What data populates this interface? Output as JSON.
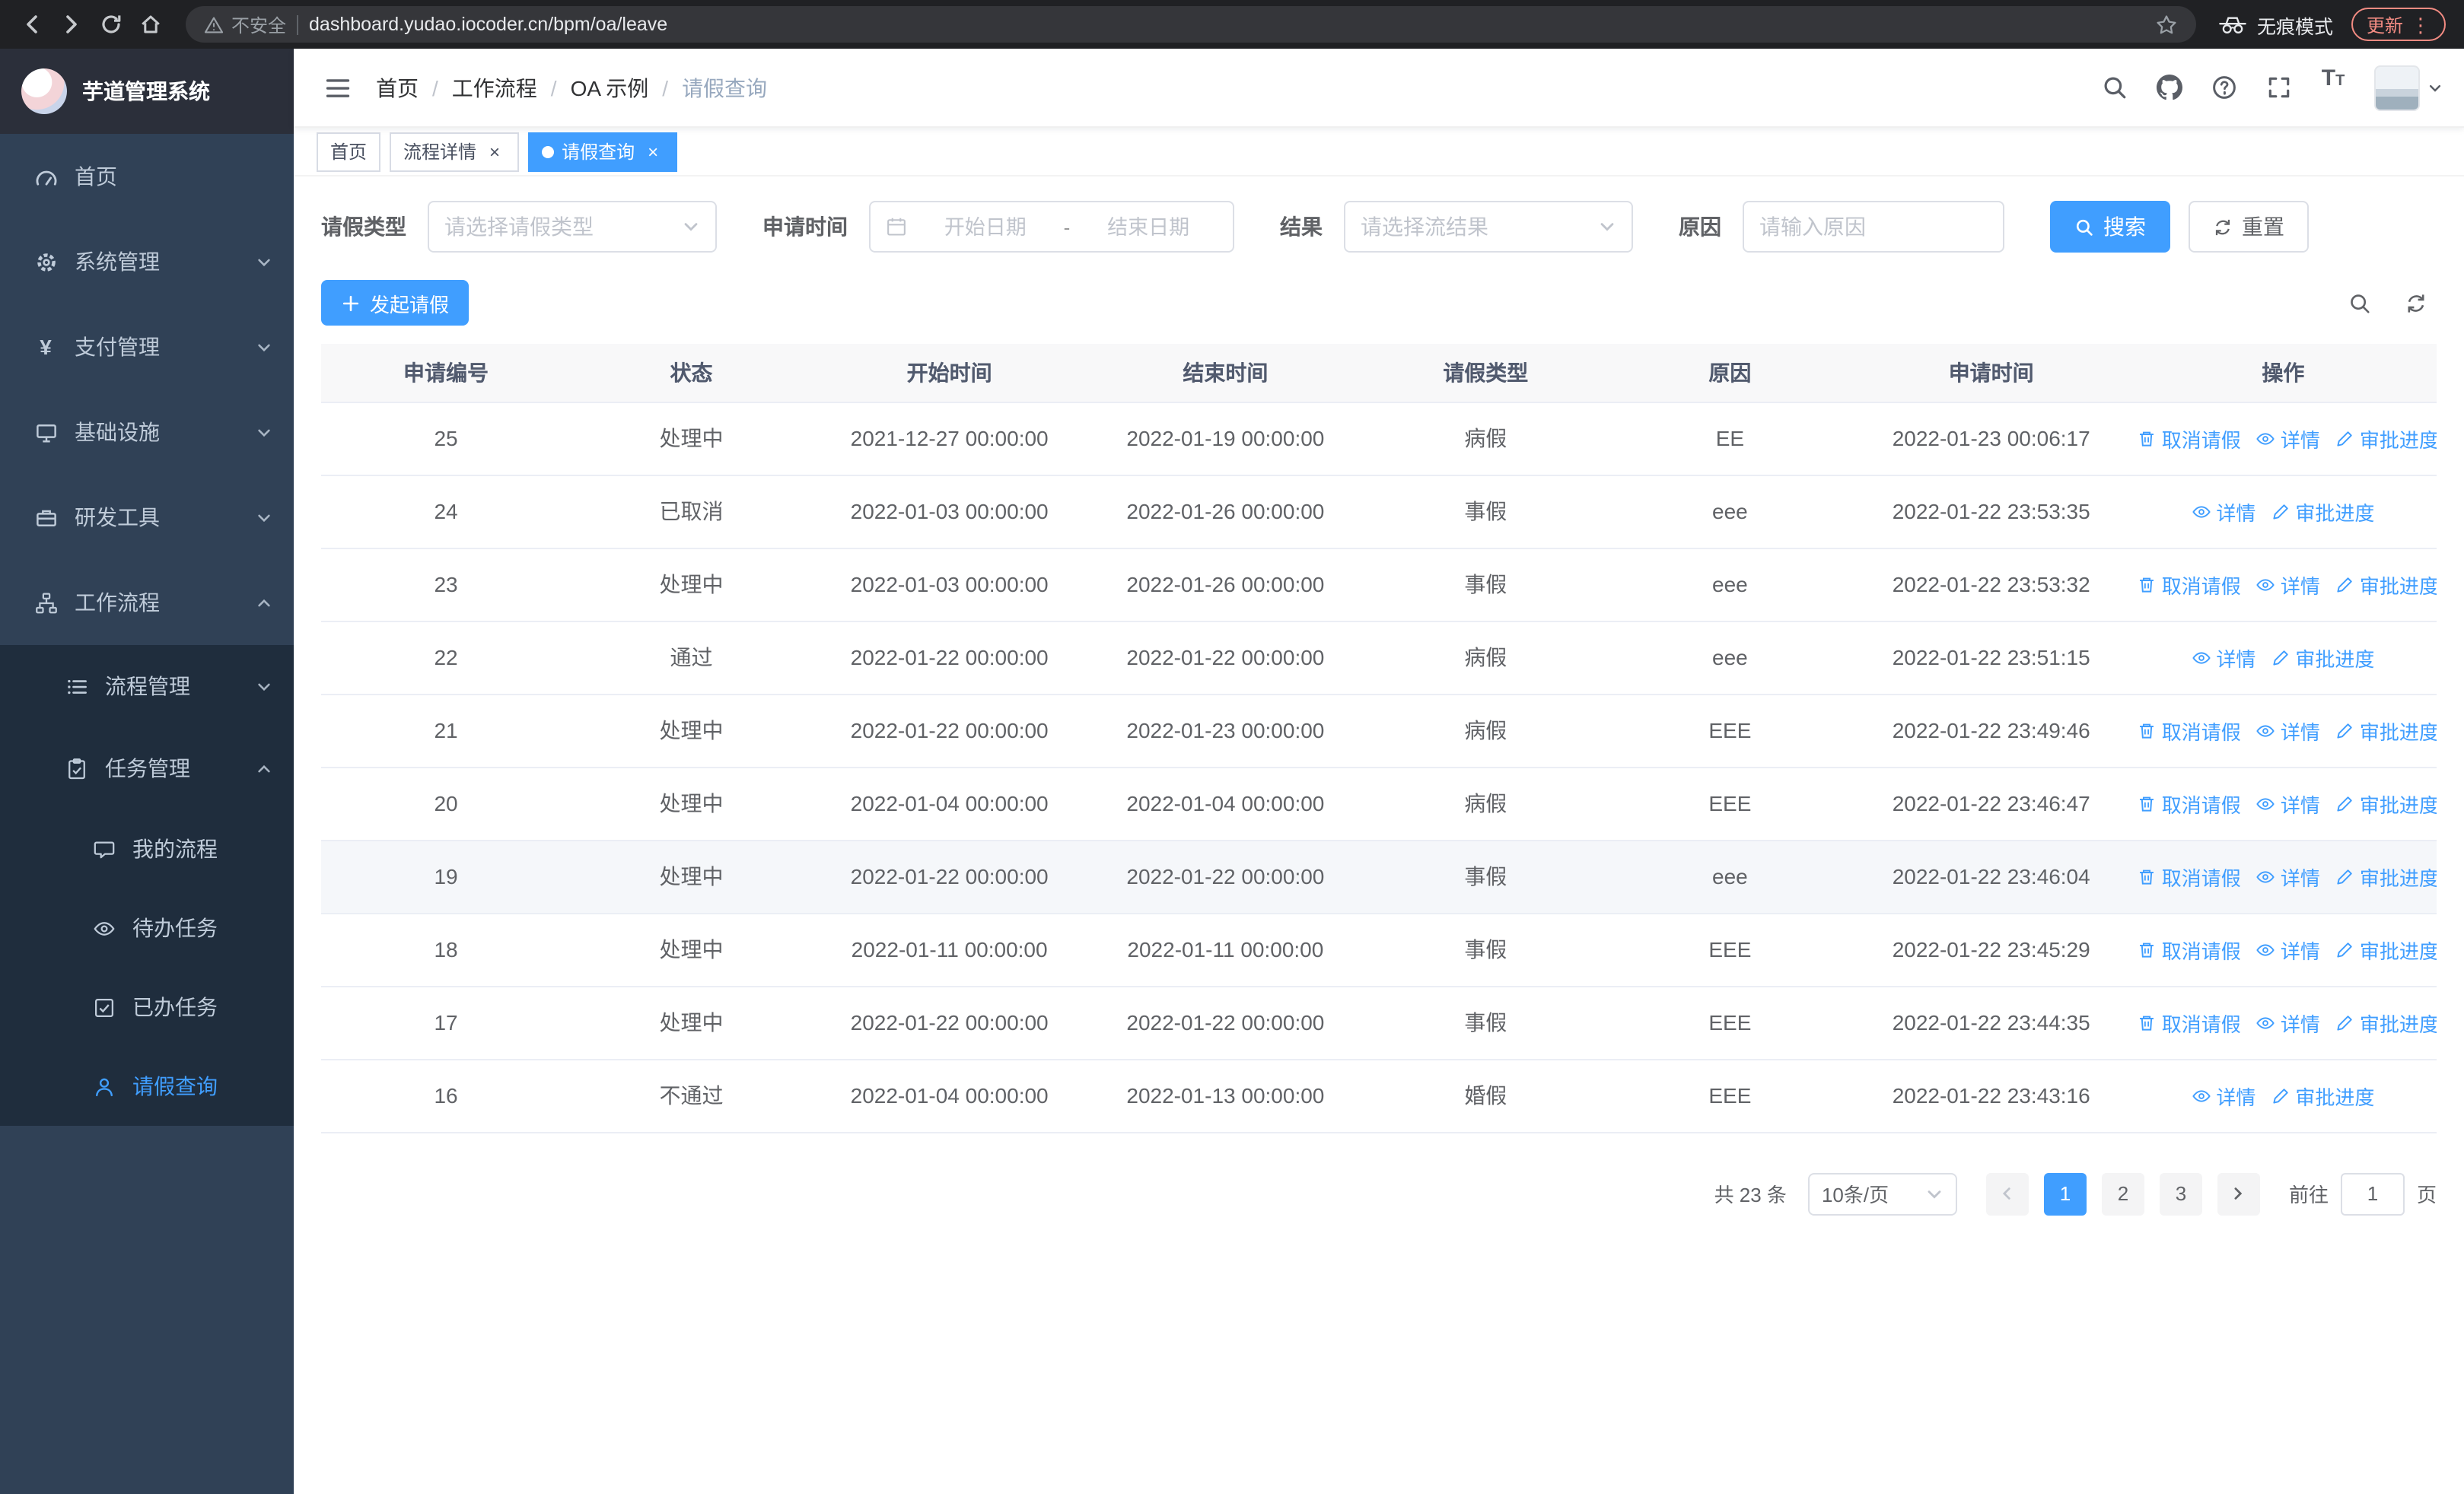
{
  "browser": {
    "security_label": "不安全",
    "url": "dashboard.yudao.iocoder.cn/bpm/oa/leave",
    "incognito_label": "无痕模式",
    "update_label": "更新"
  },
  "icons": {
    "close_glyph": "×",
    "breadcrumb_separator": "/",
    "question_glyph": "?",
    "kebab_glyph": "⋮",
    "yen_glyph": "¥",
    "font_size_glyph": "T"
  },
  "sidebar": {
    "logo_title": "芋道管理系统",
    "items": [
      {
        "label": "首页",
        "icon": "dashboard-icon"
      },
      {
        "label": "系统管理",
        "icon": "gear-icon",
        "expandable": true
      },
      {
        "label": "支付管理",
        "icon": "yen-icon",
        "expandable": true
      },
      {
        "label": "基础设施",
        "icon": "monitor-icon",
        "expandable": true
      },
      {
        "label": "研发工具",
        "icon": "briefcase-icon",
        "expandable": true
      },
      {
        "label": "工作流程",
        "icon": "workflow-icon",
        "expanded": true,
        "children": [
          {
            "label": "流程管理",
            "icon": "list-icon",
            "expandable": true
          },
          {
            "label": "任务管理",
            "icon": "tasks-icon",
            "expanded": true,
            "children": [
              {
                "label": "我的流程",
                "icon": "chat-icon"
              },
              {
                "label": "待办任务",
                "icon": "eye-icon"
              },
              {
                "label": "已办任务",
                "icon": "check-square-icon"
              },
              {
                "label": "请假查询",
                "icon": "user-icon",
                "active": true
              }
            ]
          }
        ]
      }
    ]
  },
  "header": {
    "breadcrumb": [
      "首页",
      "工作流程",
      "OA 示例",
      "请假查询"
    ]
  },
  "tabs": [
    {
      "label": "首页",
      "closable": false,
      "active": false
    },
    {
      "label": "流程详情",
      "closable": true,
      "active": false
    },
    {
      "label": "请假查询",
      "closable": true,
      "active": true
    }
  ],
  "filters": {
    "leave_type_label": "请假类型",
    "leave_type_placeholder": "请选择请假类型",
    "apply_time_label": "申请时间",
    "start_date_placeholder": "开始日期",
    "range_separator": "-",
    "end_date_placeholder": "结束日期",
    "result_label": "结果",
    "result_placeholder": "请选择流结果",
    "reason_label": "原因",
    "reason_placeholder": "请输入原因",
    "search_button": "搜索",
    "reset_button": "重置"
  },
  "toolbar": {
    "create_button": "发起请假"
  },
  "table": {
    "columns": [
      "申请编号",
      "状态",
      "开始时间",
      "结束时间",
      "请假类型",
      "原因",
      "申请时间",
      "操作"
    ],
    "action_labels": {
      "cancel": "取消请假",
      "detail": "详情",
      "progress": "审批进度"
    },
    "rows": [
      {
        "id": "25",
        "status": "处理中",
        "start": "2021-12-27 00:00:00",
        "end": "2022-01-19 00:00:00",
        "type": "病假",
        "reason": "EE",
        "applied": "2022-01-23 00:06:17",
        "actions": [
          "cancel",
          "detail",
          "progress"
        ]
      },
      {
        "id": "24",
        "status": "已取消",
        "start": "2022-01-03 00:00:00",
        "end": "2022-01-26 00:00:00",
        "type": "事假",
        "reason": "eee",
        "applied": "2022-01-22 23:53:35",
        "actions": [
          "detail",
          "progress"
        ]
      },
      {
        "id": "23",
        "status": "处理中",
        "start": "2022-01-03 00:00:00",
        "end": "2022-01-26 00:00:00",
        "type": "事假",
        "reason": "eee",
        "applied": "2022-01-22 23:53:32",
        "actions": [
          "cancel",
          "detail",
          "progress"
        ]
      },
      {
        "id": "22",
        "status": "通过",
        "start": "2022-01-22 00:00:00",
        "end": "2022-01-22 00:00:00",
        "type": "病假",
        "reason": "eee",
        "applied": "2022-01-22 23:51:15",
        "actions": [
          "detail",
          "progress"
        ]
      },
      {
        "id": "21",
        "status": "处理中",
        "start": "2022-01-22 00:00:00",
        "end": "2022-01-23 00:00:00",
        "type": "病假",
        "reason": "EEE",
        "applied": "2022-01-22 23:49:46",
        "actions": [
          "cancel",
          "detail",
          "progress"
        ]
      },
      {
        "id": "20",
        "status": "处理中",
        "start": "2022-01-04 00:00:00",
        "end": "2022-01-04 00:00:00",
        "type": "病假",
        "reason": "EEE",
        "applied": "2022-01-22 23:46:47",
        "actions": [
          "cancel",
          "detail",
          "progress"
        ]
      },
      {
        "id": "19",
        "status": "处理中",
        "start": "2022-01-22 00:00:00",
        "end": "2022-01-22 00:00:00",
        "type": "事假",
        "reason": "eee",
        "applied": "2022-01-22 23:46:04",
        "actions": [
          "cancel",
          "detail",
          "progress"
        ],
        "highlighted": true
      },
      {
        "id": "18",
        "status": "处理中",
        "start": "2022-01-11 00:00:00",
        "end": "2022-01-11 00:00:00",
        "type": "事假",
        "reason": "EEE",
        "applied": "2022-01-22 23:45:29",
        "actions": [
          "cancel",
          "detail",
          "progress"
        ]
      },
      {
        "id": "17",
        "status": "处理中",
        "start": "2022-01-22 00:00:00",
        "end": "2022-01-22 00:00:00",
        "type": "事假",
        "reason": "EEE",
        "applied": "2022-01-22 23:44:35",
        "actions": [
          "cancel",
          "detail",
          "progress"
        ]
      },
      {
        "id": "16",
        "status": "不通过",
        "start": "2022-01-04 00:00:00",
        "end": "2022-01-13 00:00:00",
        "type": "婚假",
        "reason": "EEE",
        "applied": "2022-01-22 23:43:16",
        "actions": [
          "detail",
          "progress"
        ]
      }
    ]
  },
  "pagination": {
    "total_label": "共 23 条",
    "page_size_label": "10条/页",
    "pages": [
      "1",
      "2",
      "3"
    ],
    "active_page": "1",
    "goto_label": "前往",
    "goto_value": "1",
    "goto_suffix": "页"
  }
}
